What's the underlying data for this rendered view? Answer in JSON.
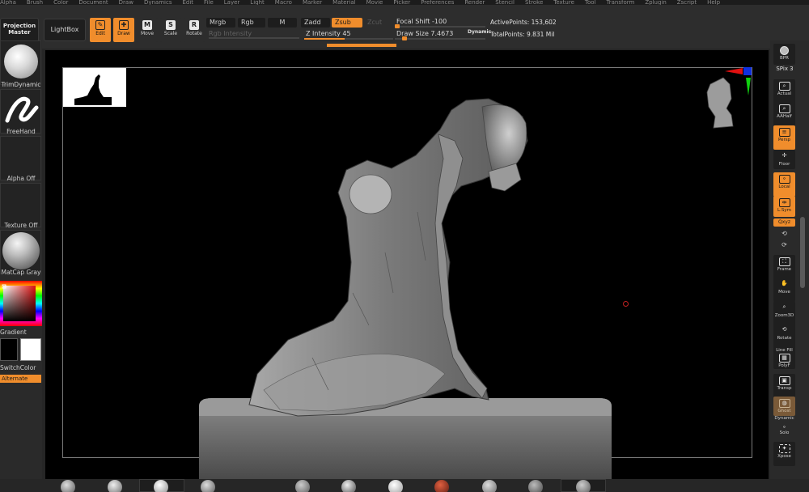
{
  "menu": [
    "Alpha",
    "Brush",
    "Color",
    "Document",
    "Draw",
    "Dynamics",
    "Edit",
    "File",
    "Layer",
    "Light",
    "Macro",
    "Marker",
    "Material",
    "Movie",
    "Picker",
    "Preferences",
    "Render",
    "Stencil",
    "Stroke",
    "Texture",
    "Tool",
    "Transform",
    "Zplugin",
    "Zscript",
    "Help"
  ],
  "toolbar": {
    "projection_master": [
      "Projection",
      "Master"
    ],
    "lightbox": "LightBox",
    "edit": "Edit",
    "draw": "Draw",
    "move": "Move",
    "scale": "Scale",
    "rotate": "Rotate",
    "mrgb": "Mrgb",
    "rgb": "Rgb",
    "m": "M",
    "rgb_intensity": "Rgb Intensity",
    "zadd": "Zadd",
    "zsub": "Zsub",
    "zcut": "Zcut",
    "z_intensity": "Z Intensity 45",
    "focal_shift": "Focal Shift -100",
    "draw_size": "Draw Size 7.4673",
    "dynamic": "Dynamic",
    "active_points": "ActivePoints: 153,602",
    "total_points": "TotalPoints: 9.831 Mil",
    "z_intensity_level": 0.45,
    "focal_shift_level": 0.0
  },
  "left_shelf": {
    "brush": "TrimDynamic",
    "stroke": "FreeHand",
    "alpha": "Alpha Off",
    "texture": "Texture Off",
    "material": "MatCap Gray",
    "gradient": "Gradient",
    "switch_color": "SwitchColor",
    "alternate": "Alternate"
  },
  "right_shelf": {
    "bpr": "BPR",
    "spix": "SPix 3",
    "actual": "Actual",
    "aahalf": "AAHalf",
    "persp": "Persp",
    "floor": "Floor",
    "local": "Local",
    "lsym": "L.Sym",
    "xyz": "Qxyz",
    "frame": "Frame",
    "move": "Move",
    "zoom3d": "Zoom3D",
    "rotate": "Rotate",
    "linefill": "Line Fill",
    "polyf": "PolyF",
    "transp": "Transp",
    "ghost": "Ghost",
    "dynamic": "Dynamic",
    "solo": "Solo",
    "xpose": "Xpose"
  },
  "colors": {
    "accent": "#f08d2c",
    "canvas_bg": "#000000",
    "panel": "#2a2a2a"
  }
}
